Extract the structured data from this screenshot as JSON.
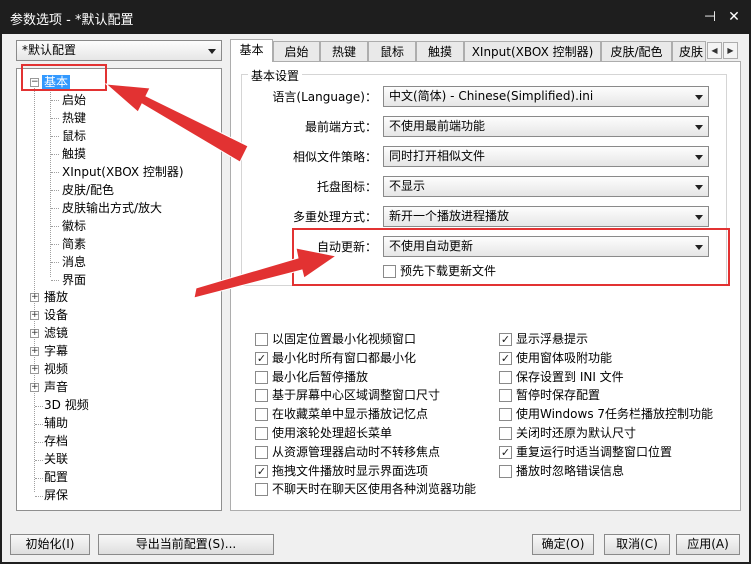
{
  "window": {
    "title": "参数选项 - *默认配置",
    "pin_glyph": "⊣",
    "close_glyph": "✕"
  },
  "profile_combo": {
    "value": "*默认配置"
  },
  "tree": {
    "root": {
      "label": "基本",
      "expander": "−"
    },
    "children": [
      "启始",
      "热键",
      "鼠标",
      "触摸",
      "XInput(XBOX 控制器)",
      "皮肤/配色",
      "皮肤输出方式/放大",
      "徽标",
      "简素",
      "消息",
      "界面"
    ],
    "collapsed": [
      {
        "label": "播放",
        "expander": "+"
      },
      {
        "label": "设备",
        "expander": "+"
      },
      {
        "label": "滤镜",
        "expander": "+"
      },
      {
        "label": "字幕",
        "expander": "+"
      },
      {
        "label": "视频",
        "expander": "+"
      },
      {
        "label": "声音",
        "expander": "+"
      }
    ],
    "leaves": [
      "3D 视频",
      "辅助",
      "存档",
      "关联",
      "配置",
      "屏保"
    ]
  },
  "tabs": {
    "items": [
      "基本",
      "启始",
      "热键",
      "鼠标",
      "触摸",
      "XInput(XBOX 控制器)",
      "皮肤/配色",
      "皮肤"
    ],
    "active_index": 0,
    "scroll_left": "◀",
    "scroll_right": "▶"
  },
  "basic": {
    "group_title": "基本设置",
    "rows": [
      {
        "label": "语言(Language)：",
        "value": "中文(简体) - Chinese(Simplified).ini"
      },
      {
        "label": "最前端方式：",
        "value": "不使用最前端功能"
      },
      {
        "label": "相似文件策略：",
        "value": "同时打开相似文件"
      },
      {
        "label": "托盘图标：",
        "value": "不显示"
      },
      {
        "label": "多重处理方式：",
        "value": "新开一个播放进程播放"
      },
      {
        "label": "自动更新：",
        "value": "不使用自动更新"
      }
    ],
    "prefetch": {
      "label": "预先下载更新文件",
      "checked": false
    }
  },
  "checkboxes": {
    "left": [
      {
        "label": "以固定位置最小化视频窗口",
        "checked": false
      },
      {
        "label": "最小化时所有窗口都最小化",
        "checked": true
      },
      {
        "label": "最小化后暂停播放",
        "checked": false
      },
      {
        "label": "基于屏幕中心区域调整窗口尺寸",
        "checked": false
      },
      {
        "label": "在收藏菜单中显示播放记忆点",
        "checked": false
      },
      {
        "label": "使用滚轮处理超长菜单",
        "checked": false
      },
      {
        "label": "从资源管理器启动时不转移焦点",
        "checked": false
      },
      {
        "label": "拖拽文件播放时显示界面选项",
        "checked": true
      },
      {
        "label": "不聊天时在聊天区使用各种浏览器功能",
        "checked": false
      }
    ],
    "right": [
      {
        "label": "显示浮悬提示",
        "checked": true
      },
      {
        "label": "使用窗体吸附功能",
        "checked": true
      },
      {
        "label": "保存设置到 INI 文件",
        "checked": false
      },
      {
        "label": "暂停时保存配置",
        "checked": false
      },
      {
        "label": "使用Windows 7任务栏播放控制功能",
        "checked": false
      },
      {
        "label": "关闭时还原为默认尺寸",
        "checked": false
      },
      {
        "label": "重复运行时适当调整窗口位置",
        "checked": true
      },
      {
        "label": "播放时忽略错误信息",
        "checked": false
      }
    ]
  },
  "footer": {
    "init": "初始化(I)",
    "export": "导出当前配置(S)...",
    "ok": "确定(O)",
    "cancel": "取消(C)",
    "apply": "应用(A)"
  },
  "check_glyph": "✓",
  "colors": {
    "annotation_red": "#e23232",
    "selection_blue": "#3399ff",
    "titlebar": "#1e1e1e"
  }
}
